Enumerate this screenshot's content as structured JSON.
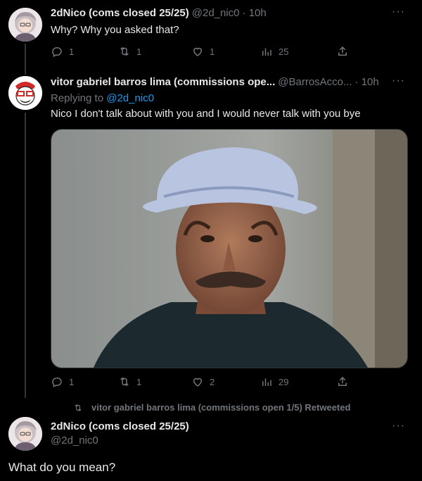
{
  "tweet1": {
    "name": "2dNico (coms closed 25/25)",
    "handle": "@2d_nic0",
    "time": "· 10h",
    "text": "Why? Why you asked that?",
    "replies": "1",
    "retweets": "1",
    "likes": "1",
    "views": "25"
  },
  "tweet2": {
    "name": "vitor gabriel barros lima (commissions ope...",
    "handle": "@BarrosAcco...",
    "time": "· 10h",
    "replying_prefix": "Replying to ",
    "replying_to": "@2d_nic0",
    "text": "Nico I don't talk about with you and I would never talk with you bye",
    "replies": "1",
    "retweets": "1",
    "likes": "2",
    "views": "29"
  },
  "retweet_note": "vitor gabriel barros lima (commissions open 1/5) Retweeted",
  "tweet3": {
    "name": "2dNico (coms closed 25/25)",
    "handle": "@2d_nic0",
    "text": "What do you mean?"
  },
  "colors": {
    "background": "#000000",
    "text": "#e7e9ea",
    "muted": "#71767b",
    "link": "#1d9bf0"
  },
  "icons": [
    "reply-icon",
    "retweet-icon",
    "like-icon",
    "views-icon",
    "share-icon",
    "more-icon"
  ]
}
